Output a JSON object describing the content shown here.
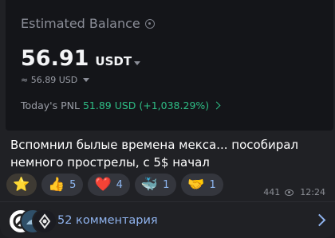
{
  "screenshot": {
    "title": "Estimated Balance",
    "balance": "56.91",
    "currency": "USDT",
    "approx": "≈ 56.89 USD",
    "pnl_label": "Today's PNL",
    "pnl_value": "51.89 USD (+1,038.29%)"
  },
  "message": {
    "text": "Вспомнил былые времена мекса... пособирал немного прострелы, с 5$ начал"
  },
  "reactions": [
    {
      "icon": "star-icon",
      "emoji": "⭐",
      "count": ""
    },
    {
      "icon": "thumbs-up-icon",
      "emoji": "👍",
      "count": "5"
    },
    {
      "icon": "heart-icon",
      "emoji": "❤️",
      "count": "4"
    },
    {
      "icon": "whale-icon",
      "emoji": "🐳",
      "count": "1"
    },
    {
      "icon": "handshake-icon",
      "emoji": "🤝",
      "count": "1"
    }
  ],
  "meta": {
    "views": "441",
    "time": "12:24"
  },
  "comments": {
    "label": "52 комментария"
  },
  "colors": {
    "accent": "#8fb3ee",
    "pnl_green": "#2ebd85"
  }
}
